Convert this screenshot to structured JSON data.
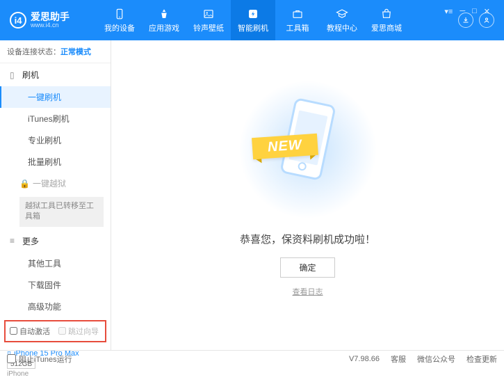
{
  "brand": {
    "title": "爱思助手",
    "url": "www.i4.cn",
    "logo_letter": "i4"
  },
  "nav": [
    {
      "label": "我的设备"
    },
    {
      "label": "应用游戏"
    },
    {
      "label": "铃声壁纸"
    },
    {
      "label": "智能刷机"
    },
    {
      "label": "工具箱"
    },
    {
      "label": "教程中心"
    },
    {
      "label": "爱思商城"
    }
  ],
  "status": {
    "prefix": "设备连接状态：",
    "mode": "正常模式"
  },
  "sidebar": {
    "group_flash": "刷机",
    "items_flash": [
      "一键刷机",
      "iTunes刷机",
      "专业刷机",
      "批量刷机"
    ],
    "group_jailbreak": "一键越狱",
    "jailbreak_note": "越狱工具已转移至工具箱",
    "group_more": "更多",
    "items_more": [
      "其他工具",
      "下载固件",
      "高级功能"
    ]
  },
  "checkboxes": {
    "auto_activate": "自动激活",
    "skip_guide": "跳过向导"
  },
  "device": {
    "name": "iPhone 15 Pro Max",
    "storage": "512GB",
    "type": "iPhone"
  },
  "main": {
    "ribbon": "NEW",
    "success": "恭喜您，保资料刷机成功啦！",
    "ok": "确定",
    "log": "查看日志"
  },
  "footer": {
    "block_itunes": "阻止iTunes运行",
    "version": "V7.98.66",
    "links": [
      "客服",
      "微信公众号",
      "检查更新"
    ]
  }
}
